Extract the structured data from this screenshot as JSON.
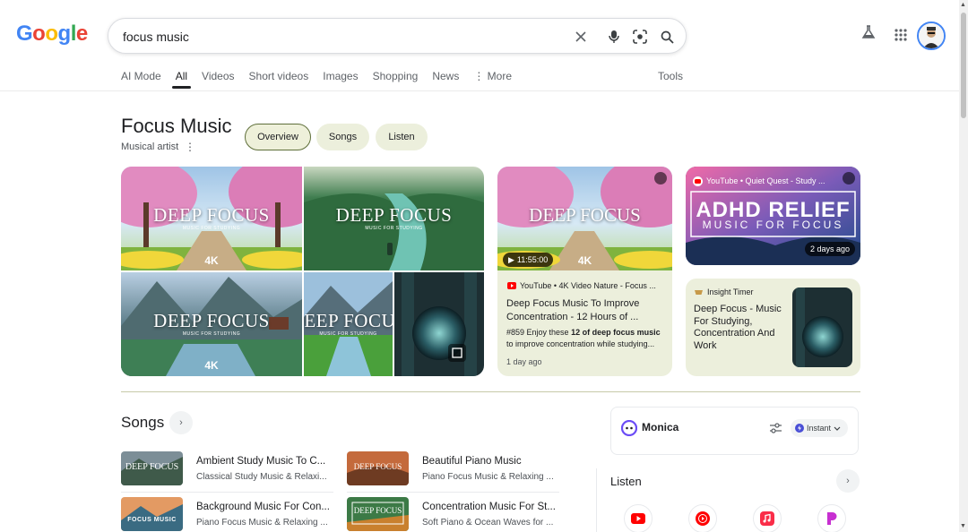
{
  "header": {
    "logo_letters": [
      {
        "ch": "G",
        "color": "#4285f4"
      },
      {
        "ch": "o",
        "color": "#ea4335"
      },
      {
        "ch": "o",
        "color": "#fbbc05"
      },
      {
        "ch": "g",
        "color": "#4285f4"
      },
      {
        "ch": "l",
        "color": "#34a853"
      },
      {
        "ch": "e",
        "color": "#ea4335"
      }
    ],
    "query": "focus music",
    "icons": [
      "clear-icon",
      "mic-icon",
      "lens-icon",
      "search-icon",
      "labs-flask-icon",
      "apps-grid-icon",
      "avatar"
    ]
  },
  "tabs": {
    "items": [
      "AI Mode",
      "All",
      "Videos",
      "Short videos",
      "Images",
      "Shopping",
      "News",
      "More"
    ],
    "active": "All",
    "tools": "Tools"
  },
  "entity": {
    "title": "Focus Music",
    "subtitle": "Musical artist",
    "chips": [
      "Overview",
      "Songs",
      "Listen"
    ]
  },
  "collage": {
    "title": "DEEP FOCUS",
    "subtitle": "MUSIC FOR STUDYING",
    "badge": "4K"
  },
  "video_card": {
    "duration": "11:55:00",
    "source": "YouTube • 4K Video Nature - Focus ...",
    "title_line1": "Deep Focus Music To Improve",
    "title_line2": "Concentration - 12 Hours of ...",
    "snippet_pre": "#859 Enjoy these ",
    "snippet_bold1": "12 of deep focus music",
    "snippet_post": " to improve concentration while studying...",
    "date": "1 day ago"
  },
  "adhd_card": {
    "source": "YouTube • Quiet Quest - Study ...",
    "line1": "ADHD RELIEF",
    "line2": "MUSIC FOR FOCUS",
    "age": "2 days ago"
  },
  "insight_card": {
    "source": "Insight Timer",
    "title": "Deep Focus - Music For Studying, Concentration And Work"
  },
  "songs": {
    "heading": "Songs",
    "items": [
      {
        "title": "Ambient Study Music To C...",
        "artist": "Classical Study Music & Relaxi...",
        "thumb": "DEEP FOCUS"
      },
      {
        "title": "Beautiful Piano Music",
        "artist": "Piano Focus Music & Relaxing ...",
        "thumb": "DEEP FOCUS"
      },
      {
        "title": "Background Music For Con...",
        "artist": "Piano Focus Music & Relaxing ...",
        "thumb": "FOCUS MUSIC"
      },
      {
        "title": "Concentration Music For St...",
        "artist": "Soft Piano & Ocean Waves for ...",
        "thumb": "DEEP FOCUS"
      }
    ]
  },
  "monica": {
    "name": "Monica",
    "mode": "Instant"
  },
  "listen": {
    "heading": "Listen",
    "services": [
      "youtube-icon",
      "youtube-music-icon",
      "apple-music-icon",
      "pandora-icon"
    ]
  }
}
